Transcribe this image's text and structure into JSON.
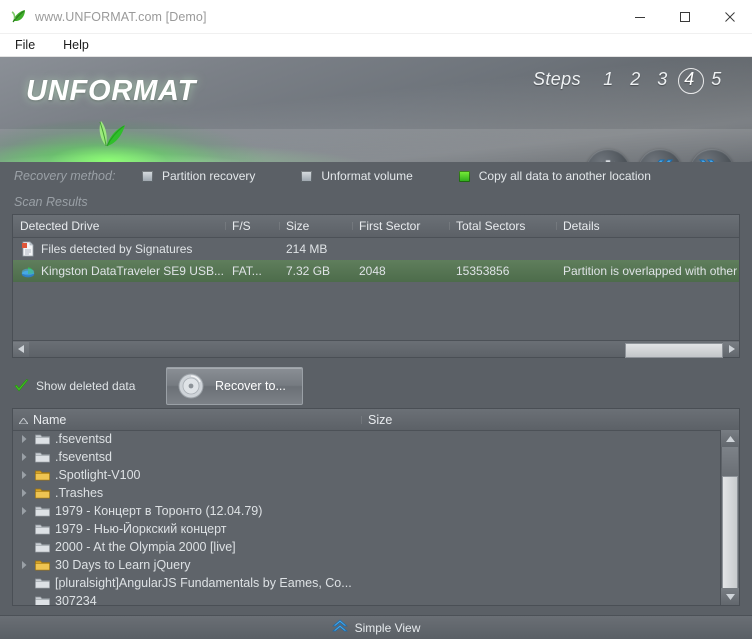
{
  "window": {
    "title": "www.UNFORMAT.com [Demo]",
    "app_icon": "leaf-icon",
    "minimize_label": "—",
    "maximize_label": "☐",
    "close_label": "✕"
  },
  "menu": {
    "items": [
      {
        "label": "File"
      },
      {
        "label": "Help"
      }
    ]
  },
  "banner": {
    "wordmark": "UNFORMAT",
    "logo": "leaf-logo",
    "steps_label": "Steps",
    "steps": [
      "1",
      "2",
      "3",
      "4",
      "5"
    ],
    "active_step": "4",
    "buttons": [
      {
        "name": "settings-button",
        "icon": "gear-icon"
      },
      {
        "name": "back-button",
        "icon": "double-chevron-left-icon"
      },
      {
        "name": "next-button",
        "icon": "double-chevron-right-icon"
      }
    ],
    "accent_green": "#4ec12a",
    "accent_blue": "#3a9fe0"
  },
  "recovery": {
    "label": "Recovery method:",
    "methods": [
      {
        "label": "Partition recovery",
        "selected": false
      },
      {
        "label": "Unformat volume",
        "selected": false
      },
      {
        "label": "Copy all data to another location",
        "selected": true
      }
    ]
  },
  "scan": {
    "section_title": "Scan Results",
    "columns": [
      "Detected Drive",
      "F/S",
      "Size",
      "First Sector",
      "Total Sectors",
      "Details"
    ],
    "rows": [
      {
        "icon": "file-signature-icon",
        "name": "Files detected by Signatures",
        "fs": "",
        "size": "214 MB",
        "first_sector": "",
        "total_sectors": "",
        "details": "",
        "selected": false
      },
      {
        "icon": "disk-icon",
        "name": "Kingston DataTraveler SE9 USB...",
        "fs": "FAT...",
        "size": "7.32 GB",
        "first_sector": "2048",
        "total_sectors": "15353856",
        "details": "Partition is overlapped with other e",
        "selected": true
      }
    ]
  },
  "actions": {
    "show_deleted_label": "Show deleted data",
    "show_deleted_checked": true,
    "recover_button_label": "Recover to...",
    "recover_button_icon": "disk-icon"
  },
  "files": {
    "columns": [
      "Name",
      "Size"
    ],
    "sort_column": "Name",
    "sort_direction": "asc",
    "rows": [
      {
        "name": ".fseventsd",
        "size": "",
        "folder": "grey",
        "expandable": true
      },
      {
        "name": ".fseventsd",
        "size": "",
        "folder": "grey",
        "expandable": true
      },
      {
        "name": ".Spotlight-V100",
        "size": "",
        "folder": "yellow",
        "expandable": true
      },
      {
        "name": ".Trashes",
        "size": "",
        "folder": "yellow",
        "expandable": true
      },
      {
        "name": "1979 - Концерт в Торонто (12.04.79)",
        "size": "",
        "folder": "grey",
        "expandable": true
      },
      {
        "name": "1979 - Нью-Йоркский концерт",
        "size": "",
        "folder": "grey",
        "expandable": false
      },
      {
        "name": "2000 - At the Olympia 2000 [live]",
        "size": "",
        "folder": "grey",
        "expandable": false
      },
      {
        "name": "30 Days to Learn jQuery",
        "size": "",
        "folder": "yellow",
        "expandable": true
      },
      {
        "name": "[pluralsight]AngularJS Fundamentals by Eames, Co...",
        "size": "",
        "folder": "grey",
        "expandable": false
      },
      {
        "name": "307234",
        "size": "",
        "folder": "grey",
        "expandable": false
      }
    ]
  },
  "statusbar": {
    "label": "Simple View",
    "icon": "double-chevron-up-icon"
  }
}
